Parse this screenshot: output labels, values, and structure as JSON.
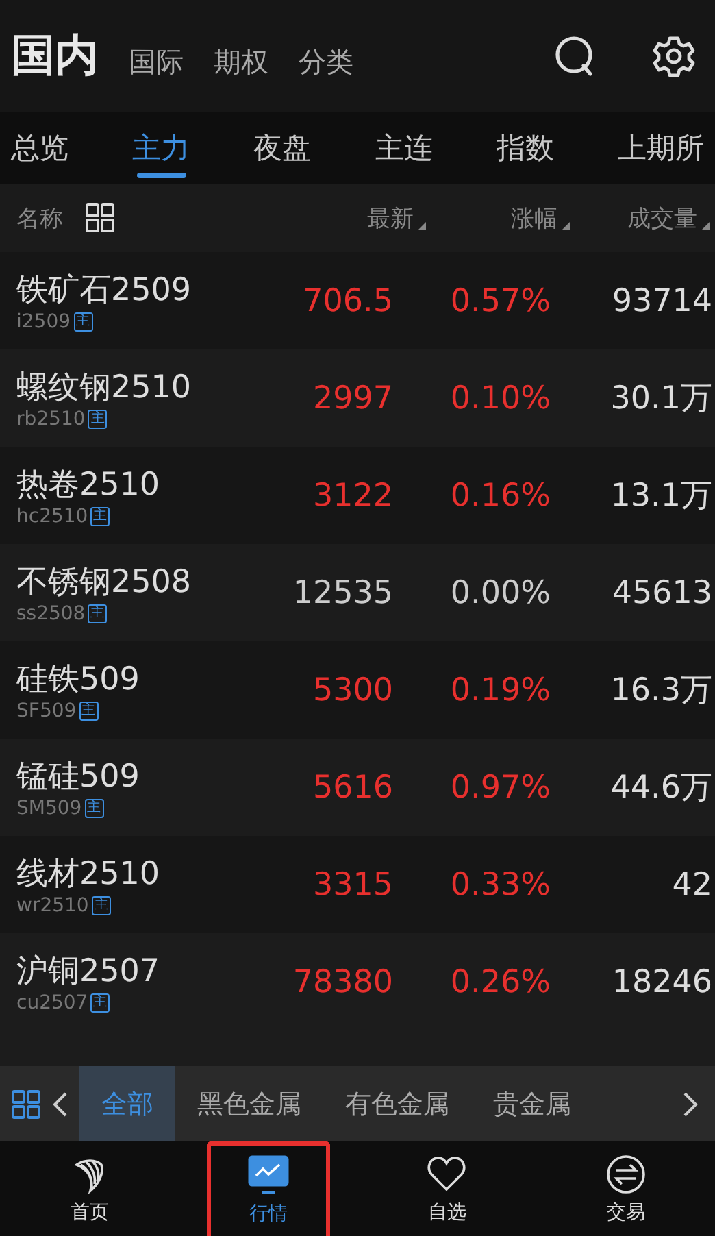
{
  "header": {
    "title": "国内",
    "tabs": [
      {
        "label": "国际"
      },
      {
        "label": "期权"
      },
      {
        "label": "分类"
      }
    ]
  },
  "subtabs": [
    {
      "label": "总览",
      "selected": false
    },
    {
      "label": "主力",
      "selected": true
    },
    {
      "label": "夜盘",
      "selected": false
    },
    {
      "label": "主连",
      "selected": false
    },
    {
      "label": "指数",
      "selected": false
    },
    {
      "label": "上期所",
      "selected": false
    }
  ],
  "columns": [
    "名称",
    "最新",
    "涨幅",
    "成交量"
  ],
  "rows": [
    {
      "name": "铁矿石2509",
      "code": "i2509",
      "badge": "主",
      "price": "706.5",
      "change": "0.57%",
      "volume": "93714",
      "rising": true
    },
    {
      "name": "螺纹钢2510",
      "code": "rb2510",
      "badge": "主",
      "price": "2997",
      "change": "0.10%",
      "volume": "30.1万",
      "rising": true
    },
    {
      "name": "热卷2510",
      "code": "hc2510",
      "badge": "主",
      "price": "3122",
      "change": "0.16%",
      "volume": "13.1万",
      "rising": true
    },
    {
      "name": "不锈钢2508",
      "code": "ss2508",
      "badge": "主",
      "price": "12535",
      "change": "0.00%",
      "volume": "45613",
      "rising": false
    },
    {
      "name": "硅铁509",
      "code": "SF509",
      "badge": "主",
      "price": "5300",
      "change": "0.19%",
      "volume": "16.3万",
      "rising": true
    },
    {
      "name": "锰硅509",
      "code": "SM509",
      "badge": "主",
      "price": "5616",
      "change": "0.97%",
      "volume": "44.6万",
      "rising": true
    },
    {
      "name": "线材2510",
      "code": "wr2510",
      "badge": "主",
      "price": "3315",
      "change": "0.33%",
      "volume": "42",
      "rising": true
    },
    {
      "name": "沪铜2507",
      "code": "cu2507",
      "badge": "主",
      "price": "78380",
      "change": "0.26%",
      "volume": "18246",
      "rising": true
    }
  ],
  "categories": [
    {
      "label": "全部",
      "selected": true
    },
    {
      "label": "黑色金属",
      "selected": false
    },
    {
      "label": "有色金属",
      "selected": false
    },
    {
      "label": "贵金属",
      "selected": false
    }
  ],
  "nav": [
    {
      "label": "首页",
      "kind": "home",
      "selected": false,
      "highlighted": false
    },
    {
      "label": "行情",
      "kind": "market",
      "selected": true,
      "highlighted": true
    },
    {
      "label": "自选",
      "kind": "watch",
      "selected": false,
      "highlighted": false
    },
    {
      "label": "交易",
      "kind": "trade",
      "selected": false,
      "highlighted": false
    }
  ]
}
